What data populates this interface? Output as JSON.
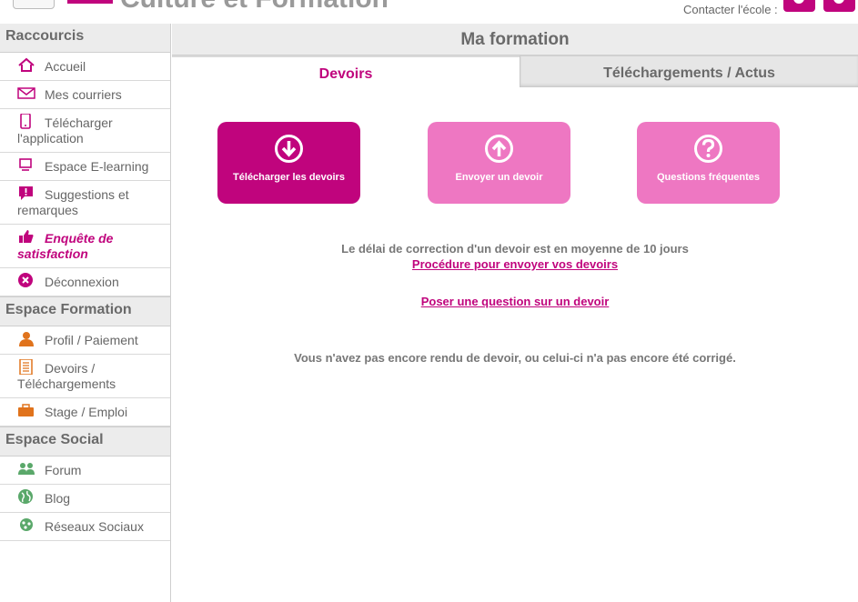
{
  "header": {
    "site_title": "Culture et Formation",
    "contact_label": "Contacter l'école :"
  },
  "sidebar": {
    "sections": [
      {
        "title": "Raccourcis",
        "items": [
          {
            "label": "Accueil",
            "icon": "home-icon"
          },
          {
            "label": "Mes courriers",
            "icon": "envelope-icon"
          },
          {
            "label": "Télécharger l'application",
            "icon": "smartphone-icon"
          },
          {
            "label": "Espace E-learning",
            "icon": "monitor-icon"
          },
          {
            "label": "Suggestions et remarques",
            "icon": "comment-alert-icon"
          },
          {
            "label": "Enquête de satisfaction",
            "icon": "thumbs-up-icon"
          },
          {
            "label": "Déconnexion",
            "icon": "logout-icon"
          }
        ]
      },
      {
        "title": "Espace Formation",
        "items": [
          {
            "label": "Profil / Paiement",
            "icon": "user-icon"
          },
          {
            "label": "Devoirs / Téléchargements",
            "icon": "document-icon"
          },
          {
            "label": "Stage / Emploi",
            "icon": "briefcase-icon"
          }
        ]
      },
      {
        "title": "Espace Social",
        "items": [
          {
            "label": "Forum",
            "icon": "users-icon"
          },
          {
            "label": "Blog",
            "icon": "globe-icon"
          },
          {
            "label": "Réseaux Sociaux",
            "icon": "network-icon"
          }
        ]
      }
    ]
  },
  "main": {
    "title": "Ma formation",
    "tabs": [
      {
        "label": "Devoirs",
        "active": true
      },
      {
        "label": "Téléchargements / Actus",
        "active": false
      }
    ],
    "tiles": [
      {
        "label": "Télécharger les devoirs",
        "icon": "download-circle-icon"
      },
      {
        "label": "Envoyer un devoir",
        "icon": "upload-circle-icon"
      },
      {
        "label": "Questions fréquentes",
        "icon": "question-circle-icon"
      }
    ],
    "delay_text": "Le délai de correction d'un devoir est en moyenne de 10 jours",
    "procedure_link": "Procédure pour envoyer vos devoirs",
    "question_link": "Poser une question sur un devoir",
    "status_text": "Vous n'avez pas encore rendu de devoir, ou celui-ci n'a pas encore été corrigé."
  },
  "colors": {
    "accent": "#c0047d",
    "accent_light": "#ee77c2",
    "sidebar_icon_pink": "#c0047d",
    "sidebar_icon_orange": "#e0731c",
    "sidebar_icon_green": "#5aa86a"
  }
}
